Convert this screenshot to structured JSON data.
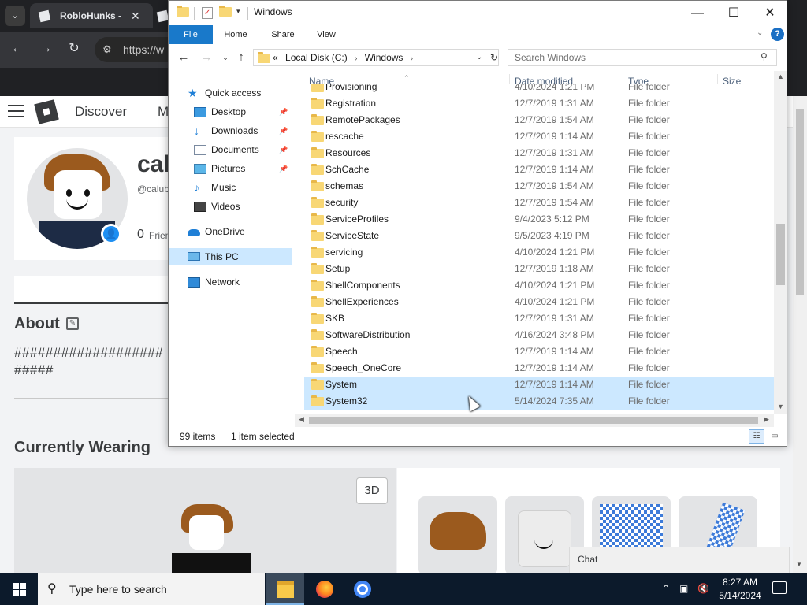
{
  "browser": {
    "tab_active_title": "RobloHunks - ",
    "tab_close": "✕",
    "url_fragment": "https://w"
  },
  "roblox": {
    "nav_discover": "Discover",
    "nav_partial": "M",
    "profile_name_partial": "cal",
    "profile_handle_partial": "@calub",
    "friends_count": "0",
    "friends_label_partial": "Frien",
    "about_title": "About",
    "about_text": "########################",
    "currently_wearing": "Currently Wearing",
    "btn_3d": "3D",
    "chat_label": "Chat"
  },
  "explorer": {
    "title": "Windows",
    "ribbon_tabs": [
      "File",
      "Home",
      "Share",
      "View"
    ],
    "address": {
      "prefix": "«",
      "crumbs": [
        "Local Disk (C:)",
        "Windows"
      ]
    },
    "search_placeholder": "Search Windows",
    "nav_pane": [
      {
        "label": "Quick access",
        "icon": "star-icon",
        "pinned": false,
        "selected": false
      },
      {
        "label": "Desktop",
        "icon": "desktop-icon",
        "pinned": true,
        "selected": false
      },
      {
        "label": "Downloads",
        "icon": "download-icon",
        "pinned": true,
        "selected": false
      },
      {
        "label": "Documents",
        "icon": "document-icon",
        "pinned": true,
        "selected": false
      },
      {
        "label": "Pictures",
        "icon": "pictures-icon",
        "pinned": true,
        "selected": false
      },
      {
        "label": "Music",
        "icon": "music-icon",
        "pinned": false,
        "selected": false
      },
      {
        "label": "Videos",
        "icon": "videos-icon",
        "pinned": false,
        "selected": false
      },
      {
        "label": "OneDrive",
        "icon": "cloud-icon",
        "pinned": false,
        "selected": false
      },
      {
        "label": "This PC",
        "icon": "computer-icon",
        "pinned": false,
        "selected": true
      },
      {
        "label": "Network",
        "icon": "network-icon",
        "pinned": false,
        "selected": false
      }
    ],
    "columns": [
      "Name",
      "Date modified",
      "Type",
      "Size"
    ],
    "files": [
      {
        "name": "Provisioning",
        "date": "4/10/2024 1:21 PM",
        "type": "File folder",
        "selected": false
      },
      {
        "name": "Registration",
        "date": "12/7/2019 1:31 AM",
        "type": "File folder",
        "selected": false
      },
      {
        "name": "RemotePackages",
        "date": "12/7/2019 1:54 AM",
        "type": "File folder",
        "selected": false
      },
      {
        "name": "rescache",
        "date": "12/7/2019 1:14 AM",
        "type": "File folder",
        "selected": false
      },
      {
        "name": "Resources",
        "date": "12/7/2019 1:31 AM",
        "type": "File folder",
        "selected": false
      },
      {
        "name": "SchCache",
        "date": "12/7/2019 1:14 AM",
        "type": "File folder",
        "selected": false
      },
      {
        "name": "schemas",
        "date": "12/7/2019 1:54 AM",
        "type": "File folder",
        "selected": false
      },
      {
        "name": "security",
        "date": "12/7/2019 1:54 AM",
        "type": "File folder",
        "selected": false
      },
      {
        "name": "ServiceProfiles",
        "date": "9/4/2023 5:12 PM",
        "type": "File folder",
        "selected": false
      },
      {
        "name": "ServiceState",
        "date": "9/5/2023 4:19 PM",
        "type": "File folder",
        "selected": false
      },
      {
        "name": "servicing",
        "date": "4/10/2024 1:21 PM",
        "type": "File folder",
        "selected": false
      },
      {
        "name": "Setup",
        "date": "12/7/2019 1:18 AM",
        "type": "File folder",
        "selected": false
      },
      {
        "name": "ShellComponents",
        "date": "4/10/2024 1:21 PM",
        "type": "File folder",
        "selected": false
      },
      {
        "name": "ShellExperiences",
        "date": "4/10/2024 1:21 PM",
        "type": "File folder",
        "selected": false
      },
      {
        "name": "SKB",
        "date": "12/7/2019 1:31 AM",
        "type": "File folder",
        "selected": false
      },
      {
        "name": "SoftwareDistribution",
        "date": "4/16/2024 3:48 PM",
        "type": "File folder",
        "selected": false
      },
      {
        "name": "Speech",
        "date": "12/7/2019 1:14 AM",
        "type": "File folder",
        "selected": false
      },
      {
        "name": "Speech_OneCore",
        "date": "12/7/2019 1:14 AM",
        "type": "File folder",
        "selected": false
      },
      {
        "name": "System",
        "date": "12/7/2019 1:14 AM",
        "type": "File folder",
        "selected": true
      },
      {
        "name": "System32",
        "date": "5/14/2024 7:35 AM",
        "type": "File folder",
        "selected": true
      }
    ],
    "status": {
      "item_count": "99 items",
      "selection": "1 item selected"
    },
    "colors": {
      "file_tab": "#1979ca",
      "selection": "#cce8ff",
      "folder": "#f8d775"
    }
  },
  "taskbar": {
    "search_placeholder": "Type here to search",
    "apps": [
      "file-explorer-icon",
      "firefox-icon",
      "chrome-icon"
    ],
    "time": "8:27 AM",
    "date": "5/14/2024"
  }
}
